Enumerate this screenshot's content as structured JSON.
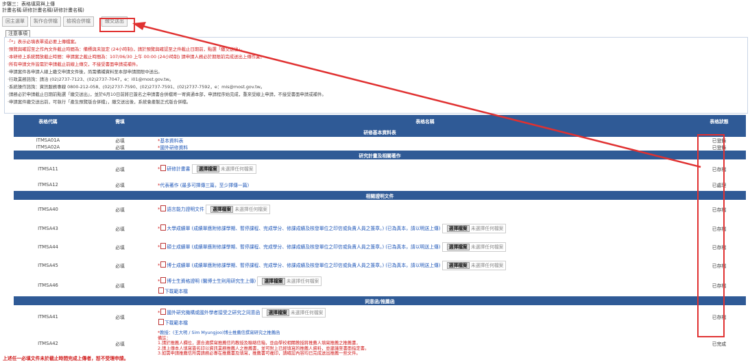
{
  "header": {
    "step": "步驟三：表格填寫與上傳",
    "plan": "計畫名稱:研修計畫名稱(研修計畫名稱)"
  },
  "toolbar": {
    "back": "回主選單",
    "b2": "製作合併檔",
    "b3": "檢視合併檔",
    "submit": "繳交送出"
  },
  "notice": {
    "tab": "注意事項",
    "lines": [
      "‧「*」表示必填表單或必要上傳檔案。",
      "‧預覽與確認至之作內文件截止時間為：備標與未設定 (24小時制)，請於預覽與確認至之件截止日期前，點選「繳交送出」。",
      "‧本研修上系統開放截止時間：申請案之截止時間為：107/06/30 上午 00:00 (24小時制) 請申請人務必於期限前完成送出上傳作業。",
      "‧所有申請文件皆需於申請截止前線上傳交，不接受書面申請或補件。",
      "‧申請案件各申請人線上繳交申請文件後，尚需備補資料至本部申請期限中送出。",
      "‧行政業務諮詢：請洽 (02)2737-7123、(02)2737-7047，e：i01@most.gov.tw。",
      "‧系統操作諮詢：資訊服務專線 0800-212-058、(02)2737-7590、(02)2737-7591、(02)2737-7592，e：mis@most.gov.tw。",
      "‧請務必於申請截止日期前點選「繳交送出」，並於6月10日前將已簽名之申請書合併檔寄一寄資通本部，申請程序始完成，重來受線上申請，不接受書面申請或補件。",
      "‧申請案件繳交送出前，可執行「產生預覽版合併檔」，繳交送出後，系統會產製正式版合併檔。"
    ]
  },
  "table": {
    "headers": [
      "表格代碼",
      "需填",
      "表格名稱",
      "表格狀態"
    ],
    "sections": [
      {
        "title": "研修基本資料表",
        "rows": [
          {
            "code": "ITMSA01A",
            "req": "必填",
            "name": "基本資料表",
            "status": "已登錄"
          },
          {
            "code": "ITMSA02A",
            "req": "必填",
            "name": "國外研修資料",
            "status": "已登錄"
          }
        ]
      },
      {
        "title": "研究計畫及相關著作",
        "rows": [
          {
            "code": "ITMSA11",
            "req": "必填",
            "name": "研修計畫書",
            "status": "已存檔"
          },
          {
            "code": "ITMSA12",
            "req": "必填",
            "name": "代表著作 (最多可擇傳三篇，至少擇傳一篇)",
            "status": "已處理"
          }
        ]
      },
      {
        "title": "相關證明文件",
        "rows": [
          {
            "code": "ITMSA40",
            "req": "必填",
            "name": "語言能力證明文件",
            "status": "已存檔"
          },
          {
            "code": "ITMSA43",
            "req": "必填",
            "name": "大學成績單 (成績單應附修課學期、暫停課程、完成學分、修課成績及核發單位之印信或負責人員之簽章。) (已為真本，請以明送上傳)",
            "status": "已存檔"
          },
          {
            "code": "ITMSA44",
            "req": "必填",
            "name": "碩士成績單 (成績單應附修課學期、暫停課程、完成學分、修課成績及核發單位之印信或負責人員之簽章。) (已為真本，請以明送上傳)",
            "status": "已存檔"
          },
          {
            "code": "ITMSA45",
            "req": "必填",
            "name": "博士成績單 (成績單應附修課學期、暫停課程、完成學分、修課成績及核發單位之印信或負責人員之簽章。) (已為真本，請以明送上傳)",
            "status": "已存檔"
          },
          {
            "code": "ITMSA46",
            "req": "必填",
            "name": "博士生資格證明 (醫博士生則用研究生上傳)",
            "status": "已存檔",
            "download": "下載範本檔"
          }
        ]
      },
      {
        "title": "同意函/推薦函",
        "rows": [
          {
            "code": "ITMSA41",
            "req": "必填",
            "name": "國外研究機構或國外學者接受之研究之同意函",
            "status": "已存檔",
            "download": "下載範本檔"
          },
          {
            "code": "ITMSA42",
            "req": "必填",
            "name": "教授：(王大明 / Sim Myungjoo)博士推薦信撰寫研究之推薦函",
            "status": "已完成",
            "notes": [
              "備註：",
              "1.請於推薦人欄位，選合適撰寫推薦信的教授及聯絡信箱，並由學校相關教授將推薦人填寫推薦之推薦書，",
              "2.請上傳本人填寫簽名印以資訊業務推薦人之推薦書，並可附上已經填寫的推薦人資料，並建議至書面指定書。",
              "3.如需申請推薦信所需請務必專在推薦書及填寫，推薦書可複印，請確認內容均已完成送出推薦一些文件。"
            ]
          }
        ]
      }
    ],
    "choose_label": "選擇檔案",
    "nofile_label": "未選擇任何檔案"
  },
  "footer": "上述任一必填文件未於截止時間完成上傳者，恕不受理申請。"
}
